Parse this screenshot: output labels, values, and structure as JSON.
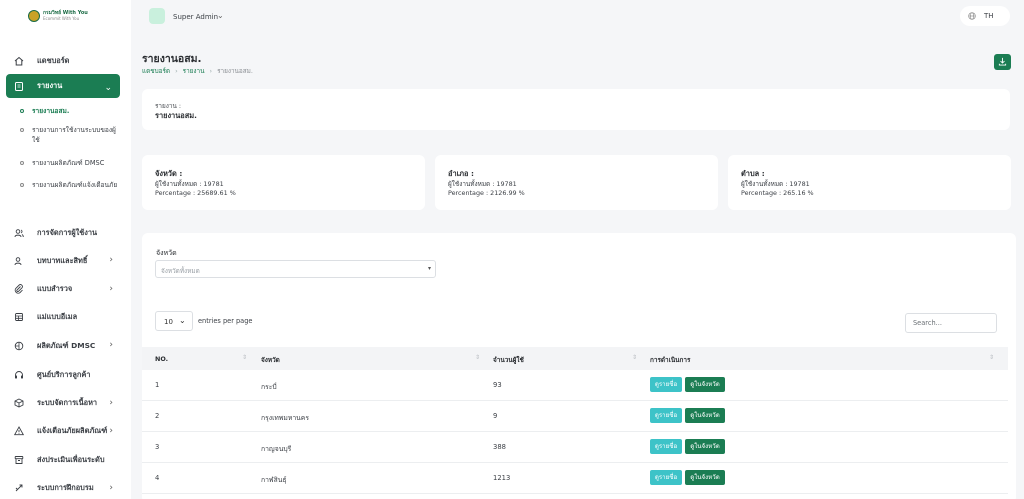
{
  "brand": {
    "title": "กรมวิทย์ With You",
    "subtitle": "Ecommit With You"
  },
  "sidebar": {
    "items": [
      {
        "label": "แดชบอร์ด",
        "icon": "home-icon"
      },
      {
        "label": "รายงาน",
        "icon": "report-icon"
      },
      {
        "label": "การจัดการผู้ใช้งาน",
        "icon": "users-icon"
      },
      {
        "label": "บทบาทและสิทธิ์",
        "icon": "role-icon"
      },
      {
        "label": "แบบสำรวจ",
        "icon": "survey-icon"
      },
      {
        "label": "แม่แบบอีเมล",
        "icon": "email-template-icon"
      },
      {
        "label": "ผลิตภัณฑ์ DMSC",
        "icon": "product-icon"
      },
      {
        "label": "ศูนย์บริการลูกค้า",
        "icon": "headset-icon"
      },
      {
        "label": "ระบบจัดการเนื้อหา",
        "icon": "content-icon"
      },
      {
        "label": "แจ้งเตือนภัยผลิตภัณฑ์",
        "icon": "alert-icon"
      },
      {
        "label": "ส่งประเมินเพื่อนระดับ",
        "icon": "inbox-icon"
      },
      {
        "label": "ระบบการฝึกอบรม",
        "icon": "training-icon"
      }
    ],
    "sub_items": [
      {
        "label": "รายงานอสม."
      },
      {
        "label": "รายงานการใช้งานระบบของผู้ใช้"
      },
      {
        "label": "รายงานผลิตภัณฑ์ DMSC"
      },
      {
        "label": "รายงานผลิตภัณฑ์แจ้งเตือนภัย"
      }
    ]
  },
  "topbar": {
    "user_name": "Super Admin",
    "language": "TH"
  },
  "page": {
    "title": "รายงานอสม.",
    "breadcrumb": [
      "แดชบอร์ด",
      "รายงาน",
      "รายงานอสม."
    ]
  },
  "report_card": {
    "label": "รายงาน :",
    "value": "รายงานอสม."
  },
  "stats": [
    {
      "title": "จังหวัด :",
      "users": "ผู้ใช้งานทั้งหมด : 19781",
      "percentage": "Percentage : 25689.61 %"
    },
    {
      "title": "อำเภอ :",
      "users": "ผู้ใช้งานทั้งหมด : 19781",
      "percentage": "Percentage : 2126.99 %"
    },
    {
      "title": "ตำบล :",
      "users": "ผู้ใช้งานทั้งหมด : 19781",
      "percentage": "Percentage : 265.16 %"
    }
  ],
  "filter": {
    "label": "จังหวัด",
    "placeholder": "จังหวัดทั้งหมด"
  },
  "table": {
    "page_length": "10",
    "entries_label": "entries per page",
    "search_placeholder": "Search...",
    "columns": [
      "NO.",
      "จังหวัด",
      "จำนวนผู้ใช้",
      "การดำเนินการ"
    ],
    "action_labels": {
      "list": "ดูรายชื่อ",
      "in_province": "ดูในจังหวัด"
    },
    "rows": [
      {
        "no": "1",
        "province": "กระบี่",
        "users": "93"
      },
      {
        "no": "2",
        "province": "กรุงเทพมหานคร",
        "users": "9"
      },
      {
        "no": "3",
        "province": "กาญจนบุรี",
        "users": "388"
      },
      {
        "no": "4",
        "province": "กาฬสินธุ์",
        "users": "1213"
      }
    ]
  }
}
